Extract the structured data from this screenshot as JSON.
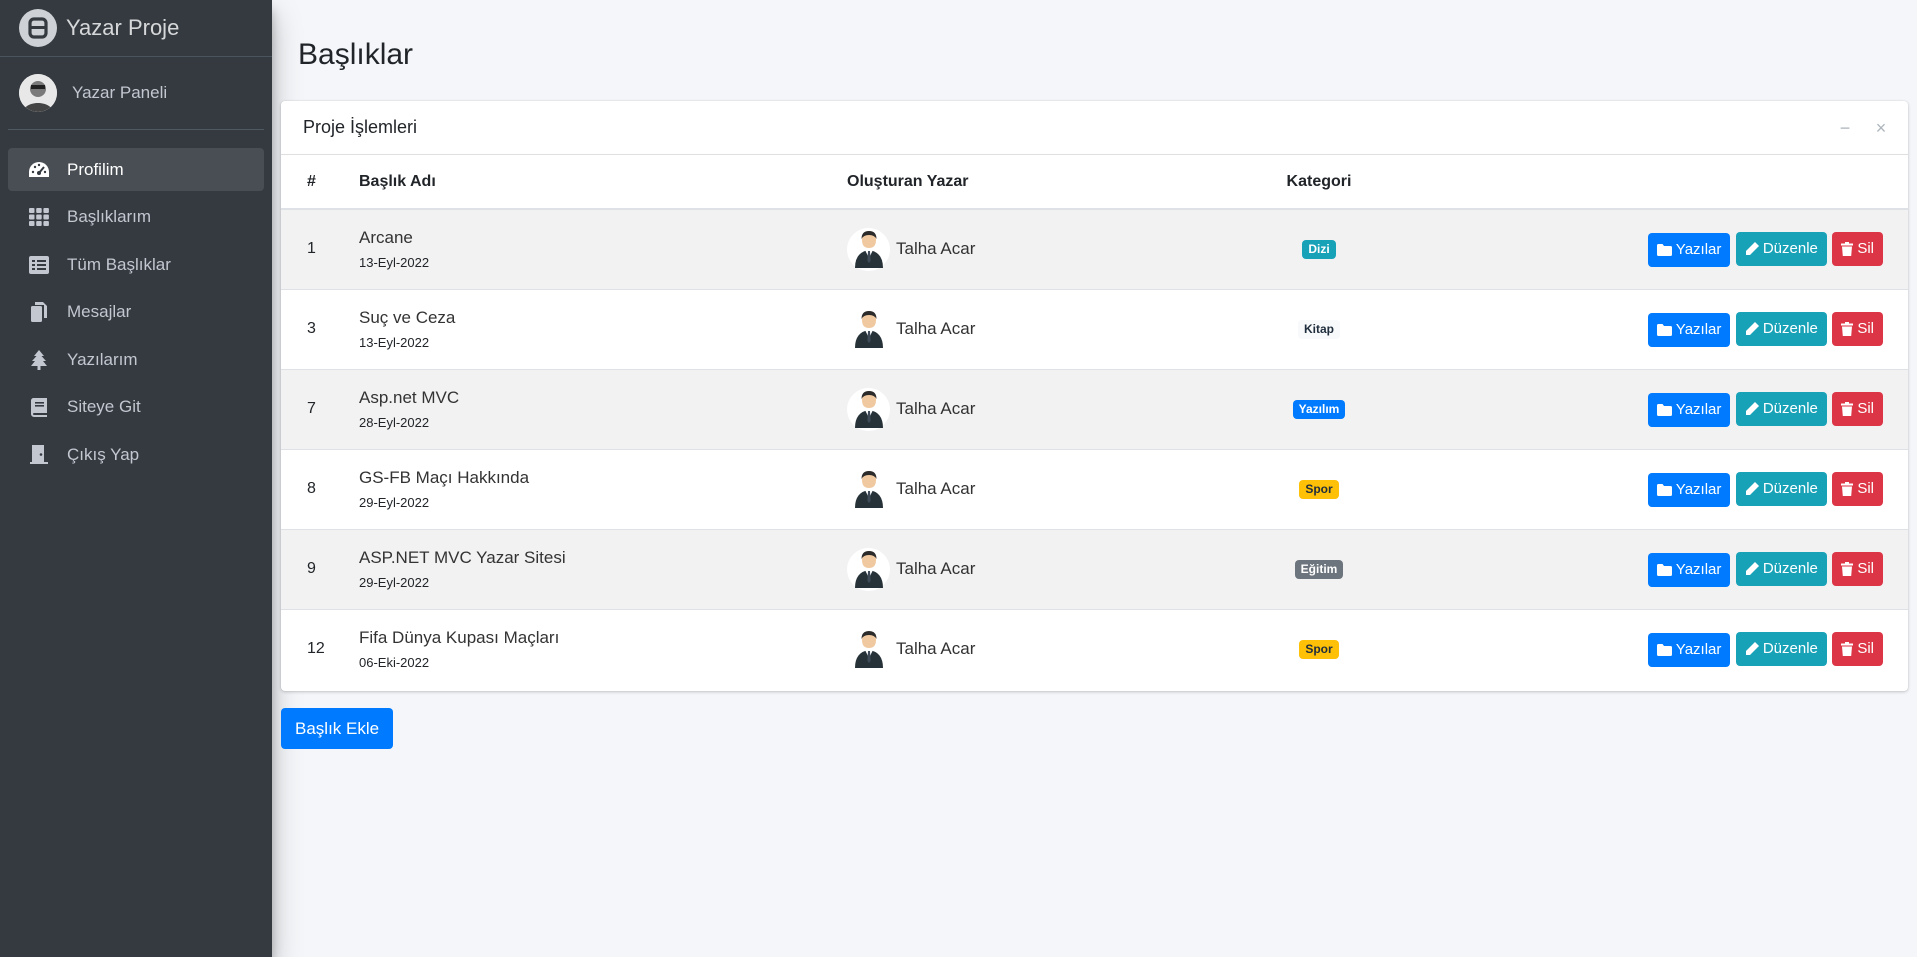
{
  "brand": {
    "title": "Yazar Proje"
  },
  "user": {
    "name": "Yazar Paneli"
  },
  "sidebar": {
    "items": [
      {
        "label": "Profilim",
        "icon": "dashboard-icon"
      },
      {
        "label": "Başlıklarım",
        "icon": "grid-icon"
      },
      {
        "label": "Tüm Başlıklar",
        "icon": "list-icon"
      },
      {
        "label": "Mesajlar",
        "icon": "copy-icon"
      },
      {
        "label": "Yazılarım",
        "icon": "tree-icon"
      },
      {
        "label": "Siteye Git",
        "icon": "book-icon"
      },
      {
        "label": "Çıkış Yap",
        "icon": "door-icon"
      }
    ]
  },
  "page": {
    "title": "Başlıklar"
  },
  "card": {
    "title": "Proje İşlemleri",
    "minimize": "−",
    "close": "×"
  },
  "table": {
    "headers": [
      "#",
      "Başlık Adı",
      "Oluşturan Yazar",
      "Kategori"
    ],
    "rows": [
      {
        "id": "1",
        "title": "Arcane",
        "date": "13-Eyl-2022",
        "author": "Talha Acar",
        "category": "Dizi",
        "cat_bg": "#17a2b8",
        "cat_fg": "#ffffff"
      },
      {
        "id": "3",
        "title": "Suç ve Ceza",
        "date": "13-Eyl-2022",
        "author": "Talha Acar",
        "category": "Kitap",
        "cat_bg": "#f8f9fa",
        "cat_fg": "#1f2d3d"
      },
      {
        "id": "7",
        "title": "Asp.net MVC",
        "date": "28-Eyl-2022",
        "author": "Talha Acar",
        "category": "Yazılım",
        "cat_bg": "#007bff",
        "cat_fg": "#ffffff"
      },
      {
        "id": "8",
        "title": "GS-FB Maçı Hakkında",
        "date": "29-Eyl-2022",
        "author": "Talha Acar",
        "category": "Spor",
        "cat_bg": "#ffc107",
        "cat_fg": "#1f2d3d"
      },
      {
        "id": "9",
        "title": "ASP.NET MVC Yazar Sitesi",
        "date": "29-Eyl-2022",
        "author": "Talha Acar",
        "category": "Eğitim",
        "cat_bg": "#6c757d",
        "cat_fg": "#ffffff"
      },
      {
        "id": "12",
        "title": "Fifa Dünya Kupası Maçları",
        "date": "06-Eki-2022",
        "author": "Talha Acar",
        "category": "Spor",
        "cat_bg": "#ffc107",
        "cat_fg": "#1f2d3d"
      }
    ],
    "actions": {
      "posts": "Yazılar",
      "edit": "Düzenle",
      "delete": "Sil"
    }
  },
  "add_button": "Başlık Ekle"
}
